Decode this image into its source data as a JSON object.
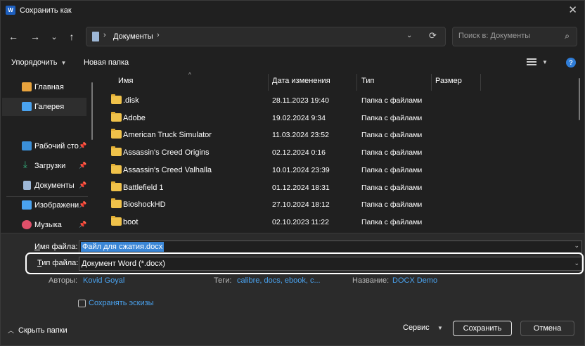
{
  "window": {
    "title": "Сохранить как",
    "app_icon_letter": "W"
  },
  "nav": {
    "back": "←",
    "forward": "→",
    "dropdown": "⌄",
    "up": "↑",
    "address_path": "Документы",
    "address_sep": "›",
    "refresh": "⟳"
  },
  "search": {
    "placeholder": "Поиск в: Документы",
    "icon": "search-icon"
  },
  "toolbar": {
    "organize": "Упорядочить",
    "new_folder": "Новая папка",
    "help": "?"
  },
  "sidebar": {
    "items": [
      {
        "label": "Главная",
        "icon": "home-icon",
        "color": "#e8a33d"
      },
      {
        "label": "Галерея",
        "icon": "gallery-icon",
        "color": "#4aa3f0"
      },
      {
        "label": "Рабочий сто",
        "icon": "desktop-icon",
        "color": "#3b8fd8"
      },
      {
        "label": "Загрузки",
        "icon": "downloads-icon",
        "color": "#36b37e"
      },
      {
        "label": "Документы",
        "icon": "documents-icon",
        "color": "#9db7d6"
      },
      {
        "label": "Изображени",
        "icon": "pictures-icon",
        "color": "#4aa3f0"
      },
      {
        "label": "Музыка",
        "icon": "music-icon",
        "color": "#e0506a"
      }
    ]
  },
  "columns": {
    "name": "Имя",
    "date": "Дата изменения",
    "type": "Тип",
    "size": "Размер"
  },
  "files": [
    {
      "name": ".disk",
      "date": "28.11.2023 19:40",
      "type": "Папка с файлами"
    },
    {
      "name": "Adobe",
      "date": "19.02.2024 9:34",
      "type": "Папка с файлами"
    },
    {
      "name": "American Truck Simulator",
      "date": "11.03.2024 23:52",
      "type": "Папка с файлами"
    },
    {
      "name": "Assassin's Creed Origins",
      "date": "02.12.2024 0:16",
      "type": "Папка с файлами"
    },
    {
      "name": "Assassin's Creed Valhalla",
      "date": "10.01.2024 23:39",
      "type": "Папка с файлами"
    },
    {
      "name": "Battlefield 1",
      "date": "01.12.2024 18:31",
      "type": "Папка с файлами"
    },
    {
      "name": "BioshockHD",
      "date": "27.10.2024 18:12",
      "type": "Папка с файлами"
    },
    {
      "name": "boot",
      "date": "02.10.2023 11:22",
      "type": "Папка с файлами"
    }
  ],
  "form": {
    "filename_label_u": "И",
    "filename_label_rest": "мя файла:",
    "filename_value": "Файл для сжатия.docx",
    "filetype_label_u": "Т",
    "filetype_label_rest": "ип файла:",
    "filetype_value": "Документ Word (*.docx)",
    "authors_label": "Авторы:",
    "authors_value": "Kovid Goyal",
    "tags_label": "Теги:",
    "tags_value": "calibre, docs, ebook, c...",
    "title_label": "Название:",
    "title_value": "DOCX Demo",
    "save_thumbnails": "Сохранять эскизы",
    "save_thumbnails_checked": false
  },
  "footer": {
    "hide_folders": "Скрыть папки",
    "service": "Сервис",
    "save": "Сохранить",
    "cancel": "Отмена"
  }
}
